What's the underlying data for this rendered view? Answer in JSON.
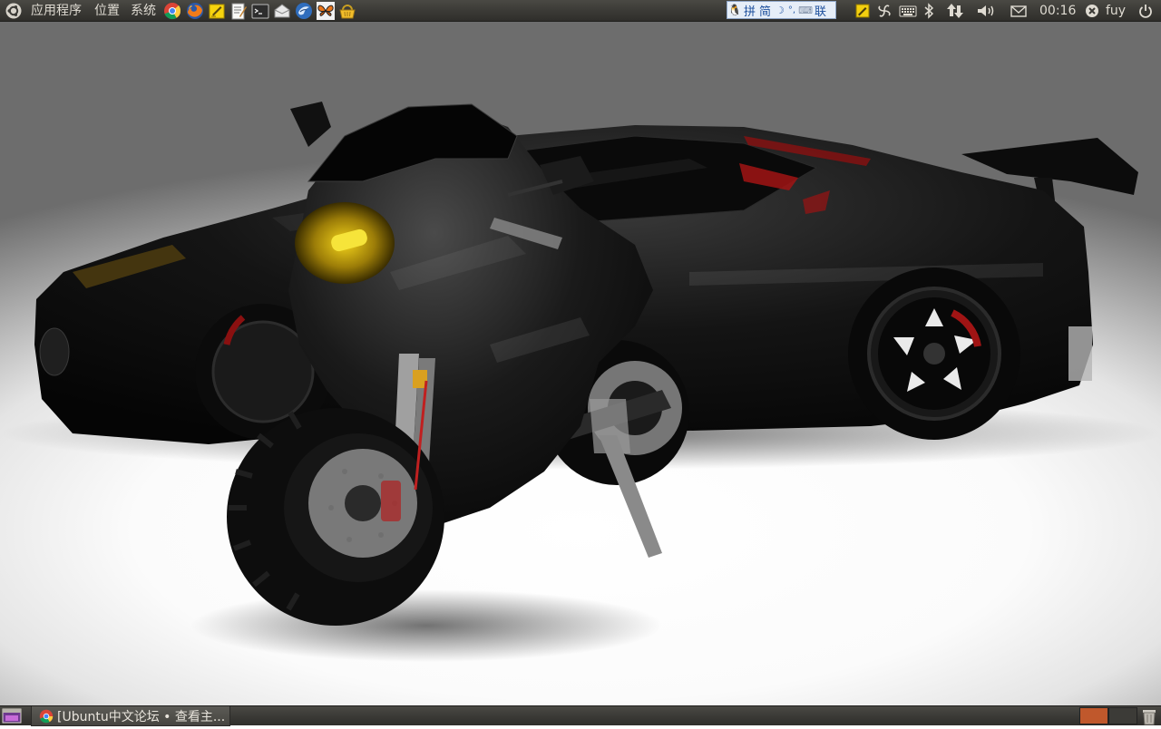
{
  "top_panel": {
    "menu": [
      {
        "label": "应用程序"
      },
      {
        "label": "位置"
      },
      {
        "label": "系统"
      }
    ],
    "launchers": [
      "chrome-icon",
      "firefox-icon",
      "sticky-notes-icon",
      "text-editor-icon",
      "terminal-icon",
      "mail-icon",
      "thunderbird-icon",
      "butterfly-app-icon",
      "basket-app-icon"
    ],
    "input_method": {
      "pinyin": "拼",
      "simplified": "简",
      "lian": "联"
    },
    "clock": "00:16",
    "user": "fuy"
  },
  "bottom_panel": {
    "task_label": "[Ubuntu中文论坛 • 查看主...",
    "workspace_colors": [
      "#c0582c",
      "#3c3b37"
    ]
  },
  "colors": {
    "panel": "#3c3b37",
    "panel_text": "#dfdbd2",
    "accent": "#dd4814"
  }
}
